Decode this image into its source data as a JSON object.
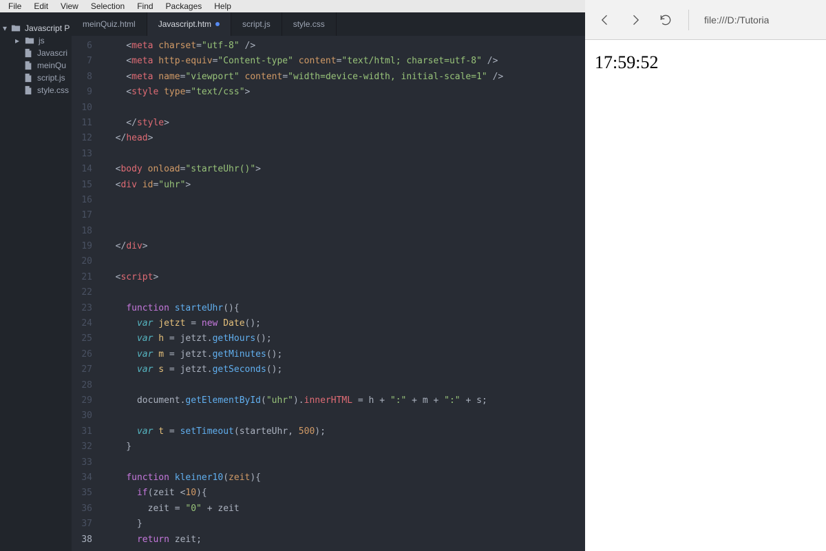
{
  "menu": [
    "File",
    "Edit",
    "View",
    "Selection",
    "Find",
    "Packages",
    "Help"
  ],
  "sidebar": {
    "root": "Javascript P",
    "folder": "js",
    "files": [
      "Javascri",
      "meinQu",
      "script.js",
      "style.css"
    ]
  },
  "tabs": [
    {
      "label": "meinQuiz.html",
      "active": false,
      "dirty": false
    },
    {
      "label": "Javascript.htm",
      "active": true,
      "dirty": true
    },
    {
      "label": "script.js",
      "active": false,
      "dirty": false
    },
    {
      "label": "style.css",
      "active": false,
      "dirty": false
    }
  ],
  "line_start": 6,
  "line_end": 38,
  "current_line": 38,
  "code": [
    [
      [
        "    <",
        "p"
      ],
      [
        "meta",
        "t"
      ],
      [
        " ",
        "p"
      ],
      [
        "charset",
        "a"
      ],
      [
        "=",
        "p"
      ],
      [
        "\"utf-8\"",
        "s"
      ],
      [
        " />",
        "p"
      ]
    ],
    [
      [
        "    <",
        "p"
      ],
      [
        "meta",
        "t"
      ],
      [
        " ",
        "p"
      ],
      [
        "http-equiv",
        "a"
      ],
      [
        "=",
        "p"
      ],
      [
        "\"Content-type\"",
        "s"
      ],
      [
        " ",
        "p"
      ],
      [
        "content",
        "a"
      ],
      [
        "=",
        "p"
      ],
      [
        "\"text/html; charset=utf-8\"",
        "s"
      ],
      [
        " />",
        "p"
      ]
    ],
    [
      [
        "    <",
        "p"
      ],
      [
        "meta",
        "t"
      ],
      [
        " ",
        "p"
      ],
      [
        "name",
        "a"
      ],
      [
        "=",
        "p"
      ],
      [
        "\"viewport\"",
        "s"
      ],
      [
        " ",
        "p"
      ],
      [
        "content",
        "a"
      ],
      [
        "=",
        "p"
      ],
      [
        "\"width=device-width, initial-scale=1\"",
        "s"
      ],
      [
        " />",
        "p"
      ]
    ],
    [
      [
        "    <",
        "p"
      ],
      [
        "style",
        "t"
      ],
      [
        " ",
        "p"
      ],
      [
        "type",
        "a"
      ],
      [
        "=",
        "p"
      ],
      [
        "\"text/css\"",
        "s"
      ],
      [
        ">",
        "p"
      ]
    ],
    [],
    [
      [
        "    </",
        "p"
      ],
      [
        "style",
        "t"
      ],
      [
        ">",
        "p"
      ]
    ],
    [
      [
        "  </",
        "p"
      ],
      [
        "head",
        "t"
      ],
      [
        ">",
        "p"
      ]
    ],
    [],
    [
      [
        "  <",
        "p"
      ],
      [
        "body",
        "t"
      ],
      [
        " ",
        "p"
      ],
      [
        "onload",
        "a"
      ],
      [
        "=",
        "p"
      ],
      [
        "\"starteUhr()\"",
        "s"
      ],
      [
        ">",
        "p"
      ]
    ],
    [
      [
        "  <",
        "p"
      ],
      [
        "div",
        "t"
      ],
      [
        " ",
        "p"
      ],
      [
        "id",
        "a"
      ],
      [
        "=",
        "p"
      ],
      [
        "\"uhr\"",
        "s"
      ],
      [
        ">",
        "p"
      ]
    ],
    [],
    [],
    [],
    [
      [
        "  </",
        "p"
      ],
      [
        "div",
        "t"
      ],
      [
        ">",
        "p"
      ]
    ],
    [],
    [
      [
        "  <",
        "p"
      ],
      [
        "script",
        "t"
      ],
      [
        ">",
        "p"
      ]
    ],
    [],
    [
      [
        "    ",
        "p"
      ],
      [
        "function ",
        "kw"
      ],
      [
        "starteUhr",
        "fn"
      ],
      [
        "(){",
        "p"
      ]
    ],
    [
      [
        "      ",
        "p"
      ],
      [
        "var ",
        "kw2"
      ],
      [
        "jetzt",
        "varname"
      ],
      [
        " = ",
        "p"
      ],
      [
        "new ",
        "kw"
      ],
      [
        "Date",
        "obj"
      ],
      [
        "();",
        "p"
      ]
    ],
    [
      [
        "      ",
        "p"
      ],
      [
        "var ",
        "kw2"
      ],
      [
        "h",
        "varname"
      ],
      [
        " = ",
        "p"
      ],
      [
        "jetzt",
        "var"
      ],
      [
        ".",
        "p"
      ],
      [
        "getHours",
        "fn"
      ],
      [
        "();",
        "p"
      ]
    ],
    [
      [
        "      ",
        "p"
      ],
      [
        "var ",
        "kw2"
      ],
      [
        "m",
        "varname"
      ],
      [
        " = ",
        "p"
      ],
      [
        "jetzt",
        "var"
      ],
      [
        ".",
        "p"
      ],
      [
        "getMinutes",
        "fn"
      ],
      [
        "();",
        "p"
      ]
    ],
    [
      [
        "      ",
        "p"
      ],
      [
        "var ",
        "kw2"
      ],
      [
        "s",
        "varname"
      ],
      [
        " = ",
        "p"
      ],
      [
        "jetzt",
        "var"
      ],
      [
        ".",
        "p"
      ],
      [
        "getSeconds",
        "fn"
      ],
      [
        "();",
        "p"
      ]
    ],
    [],
    [
      [
        "      ",
        "p"
      ],
      [
        "document",
        "var"
      ],
      [
        ".",
        "p"
      ],
      [
        "getElementById",
        "fn"
      ],
      [
        "(",
        "p"
      ],
      [
        "\"uhr\"",
        "s"
      ],
      [
        ").",
        "p"
      ],
      [
        "innerHTML",
        "prop"
      ],
      [
        " = h + ",
        "p"
      ],
      [
        "\":\"",
        "s"
      ],
      [
        " + m + ",
        "p"
      ],
      [
        "\":\"",
        "s"
      ],
      [
        " + s;",
        "p"
      ]
    ],
    [],
    [
      [
        "      ",
        "p"
      ],
      [
        "var ",
        "kw2"
      ],
      [
        "t",
        "varname"
      ],
      [
        " = ",
        "p"
      ],
      [
        "setTimeout",
        "fn"
      ],
      [
        "(starteUhr, ",
        "p"
      ],
      [
        "500",
        "num"
      ],
      [
        ");",
        "p"
      ]
    ],
    [
      [
        "    }",
        "p"
      ]
    ],
    [],
    [
      [
        "    ",
        "p"
      ],
      [
        "function ",
        "kw"
      ],
      [
        "kleiner10",
        "fn"
      ],
      [
        "(",
        "p"
      ],
      [
        "zeit",
        "a"
      ],
      [
        "){",
        "p"
      ]
    ],
    [
      [
        "      ",
        "p"
      ],
      [
        "if",
        "kw"
      ],
      [
        "(zeit <",
        "p"
      ],
      [
        "10",
        "num"
      ],
      [
        "){",
        "p"
      ]
    ],
    [
      [
        "        zeit = ",
        "p"
      ],
      [
        "\"0\"",
        "s"
      ],
      [
        " + zeit",
        "p"
      ]
    ],
    [
      [
        "      }",
        "p"
      ]
    ],
    [
      [
        "      ",
        "p"
      ],
      [
        "return ",
        "kw"
      ],
      [
        "zeit;",
        "p"
      ]
    ]
  ],
  "browser": {
    "url": "file:///D:/Tutoria",
    "clock": "17:59:52"
  }
}
